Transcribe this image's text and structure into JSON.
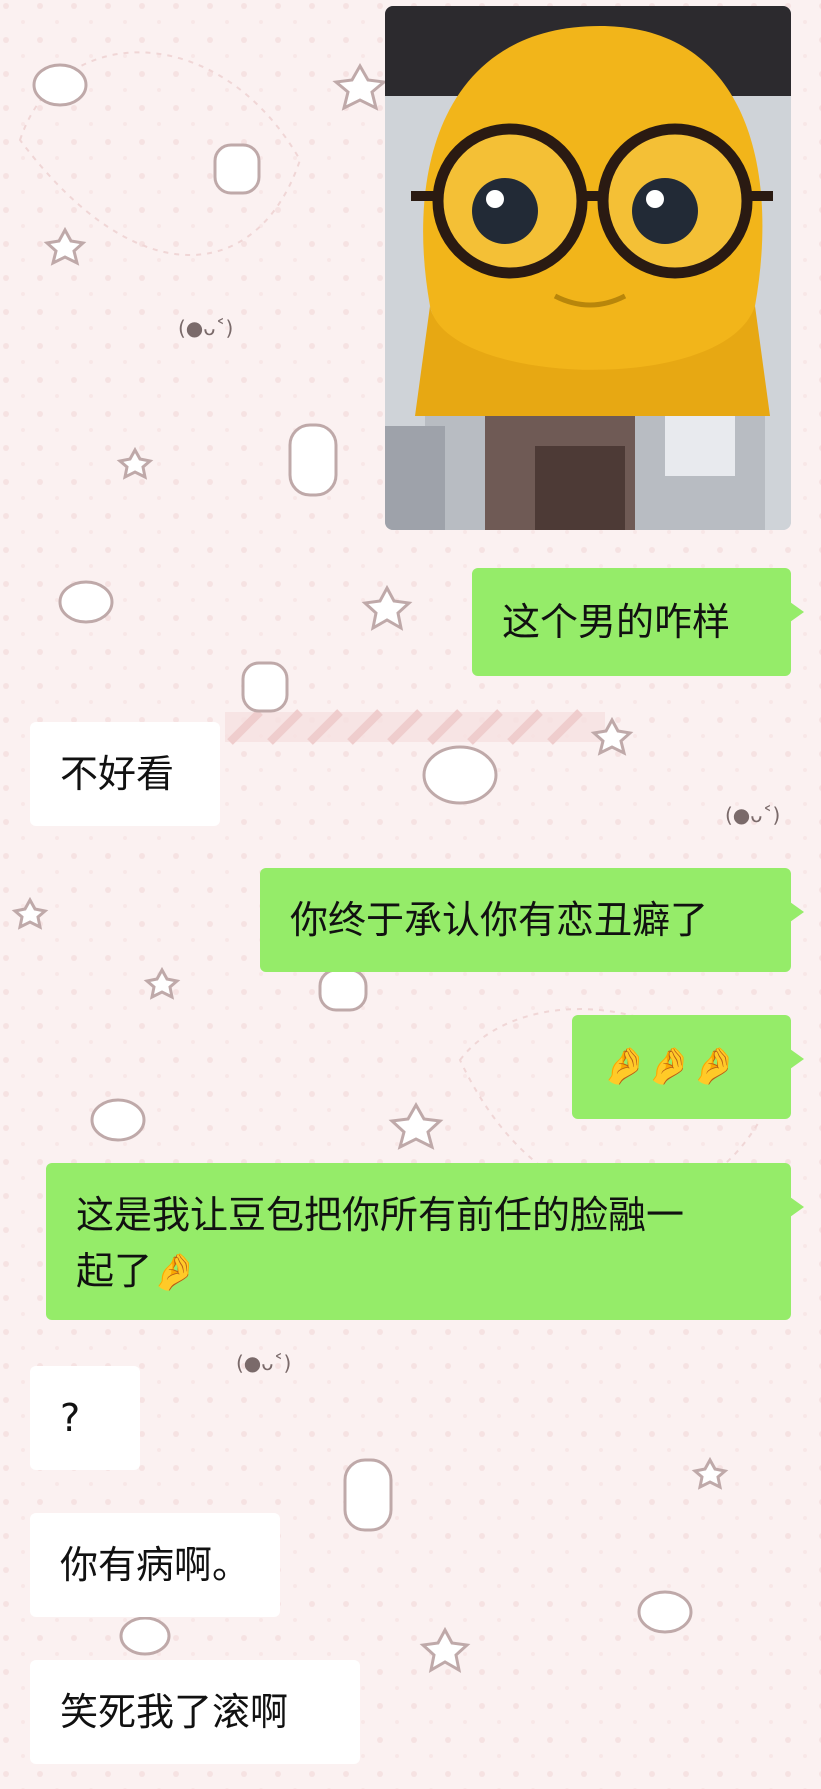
{
  "theme": {
    "sent_bubble": "#95ec69",
    "received_bubble": "#ffffff",
    "wallpaper": "#fbf1f1"
  },
  "wallpaper_kaomoji": "(●ᴗ˂)",
  "photo": {
    "icon": "yellow-face-with-glasses-image"
  },
  "messages": [
    {
      "from": "me",
      "text": "这个男的咋样"
    },
    {
      "from": "them",
      "text": "不好看"
    },
    {
      "from": "me",
      "text": "你终于承认你有恋丑癖了"
    },
    {
      "from": "me",
      "text": "🤌🤌🤌"
    },
    {
      "from": "me",
      "text": "这是我让豆包把你所有前任的脸融一",
      "text2": "起了",
      "emoji": "🤌"
    },
    {
      "from": "them",
      "text": "?"
    },
    {
      "from": "them",
      "text": "你有病啊。"
    },
    {
      "from": "them",
      "text": "笑死我了滚啊"
    }
  ]
}
